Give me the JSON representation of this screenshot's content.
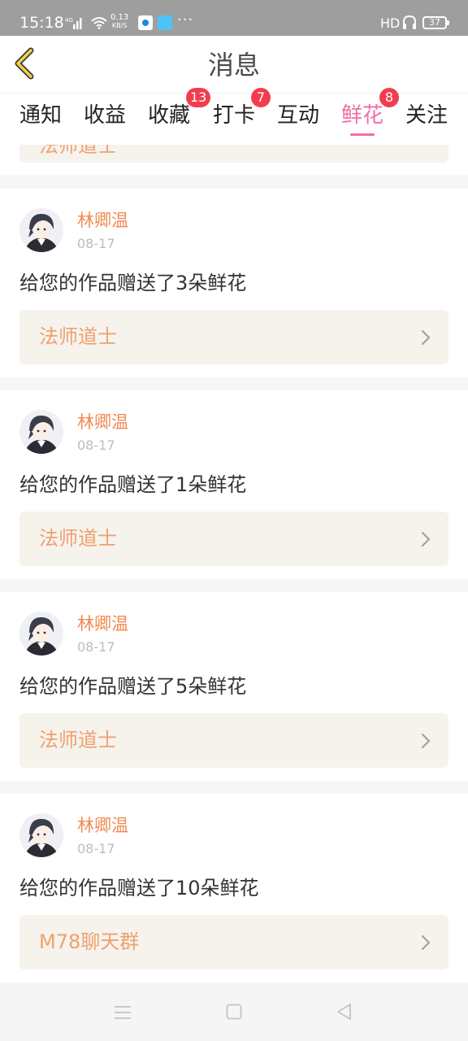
{
  "status_bar": {
    "time": "15:18",
    "network": "4G",
    "speed_value": "0.13",
    "speed_unit": "KB/S",
    "more": "···",
    "hd": "HD",
    "battery": "37"
  },
  "header": {
    "title": "消息",
    "back_icon": "chevron-left-icon"
  },
  "tabs": [
    {
      "label": "通知"
    },
    {
      "label": "收益"
    },
    {
      "label": "收藏",
      "badge": "13"
    },
    {
      "label": "打卡",
      "badge": "7"
    },
    {
      "label": "互动"
    },
    {
      "label": "鲜花",
      "badge": "8",
      "active": true
    },
    {
      "label": "关注"
    }
  ],
  "colors": {
    "accent": "#ef6fa8",
    "badge": "#f23d4f",
    "username": "#f08a52",
    "work_title": "#f0a070",
    "work_bg": "#f5f3ec"
  },
  "partial_card": {
    "work_title": "法师道士"
  },
  "cards": [
    {
      "user": "林卿温",
      "date": "08-17",
      "message": "给您的作品赠送了3朵鲜花",
      "work": "法师道士"
    },
    {
      "user": "林卿温",
      "date": "08-17",
      "message": "给您的作品赠送了1朵鲜花",
      "work": "法师道士"
    },
    {
      "user": "林卿温",
      "date": "08-17",
      "message": "给您的作品赠送了5朵鲜花",
      "work": "法师道士"
    },
    {
      "user": "林卿温",
      "date": "08-17",
      "message": "给您的作品赠送了10朵鲜花",
      "work": "M78聊天群"
    }
  ],
  "nav_bar": {
    "menu_icon": "menu-icon",
    "home_icon": "home-icon",
    "back_icon": "back-triangle-icon"
  }
}
